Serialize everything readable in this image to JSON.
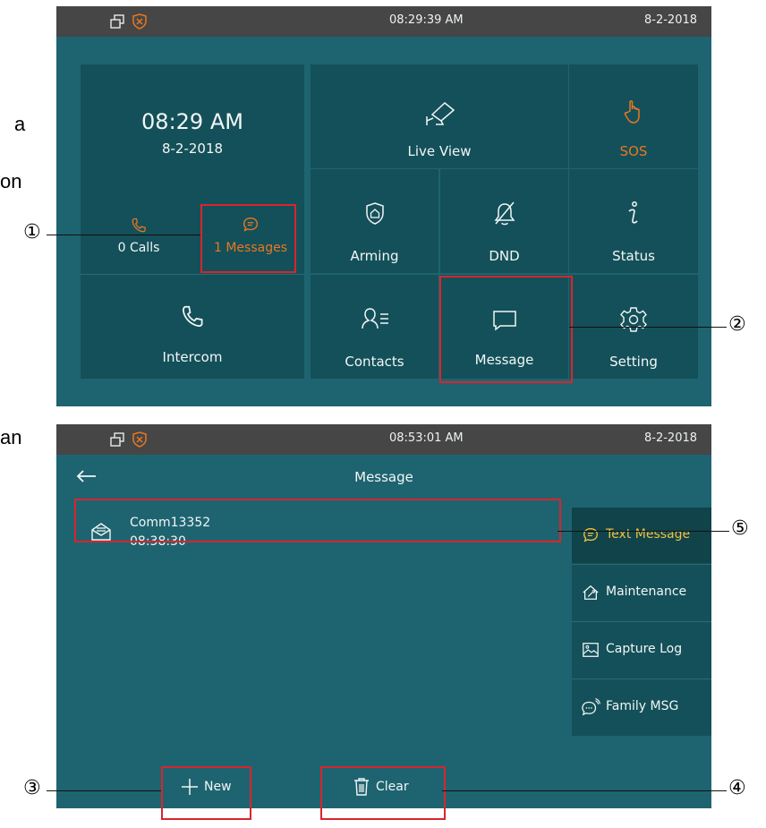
{
  "margin_text": {
    "a": "a",
    "on": "on",
    "an": "an"
  },
  "home": {
    "status_bar": {
      "time": "08:29:39   AM",
      "date": "8-2-2018"
    },
    "clock": {
      "time": "08:29 AM",
      "date": "8-2-2018"
    },
    "calls": {
      "label": "0 Calls"
    },
    "messages": {
      "label": "1 Messages"
    },
    "intercom": {
      "label": "Intercom"
    },
    "tiles": {
      "live_view": "Live View",
      "sos": "SOS",
      "arming": "Arming",
      "dnd": "DND",
      "status": "Status",
      "contacts": "Contacts",
      "message": "Message",
      "setting": "Setting"
    }
  },
  "message_screen": {
    "status_bar": {
      "time": "08:53:01   AM",
      "date": "8-2-2018"
    },
    "title": "Message",
    "back_icon": "arrow-left-icon",
    "list": [
      {
        "sender": "Comm13352",
        "time": "08:38:30"
      }
    ],
    "side_menu": [
      {
        "label": "Text Message",
        "active": true
      },
      {
        "label": "Maintenance",
        "active": false
      },
      {
        "label": "Capture Log",
        "active": false
      },
      {
        "label": "Family MSG",
        "active": false
      }
    ],
    "buttons": {
      "new": "New",
      "clear": "Clear"
    }
  },
  "callouts": {
    "c1": "①",
    "c2": "②",
    "c3": "③",
    "c4": "④",
    "c5": "⑤"
  },
  "colors": {
    "accent_orange": "#e87722",
    "highlight_red": "#d8252d",
    "tile": "#145059",
    "screen_bg": "#1e6470",
    "status_bar": "#464646",
    "active_text": "#f0c040"
  }
}
